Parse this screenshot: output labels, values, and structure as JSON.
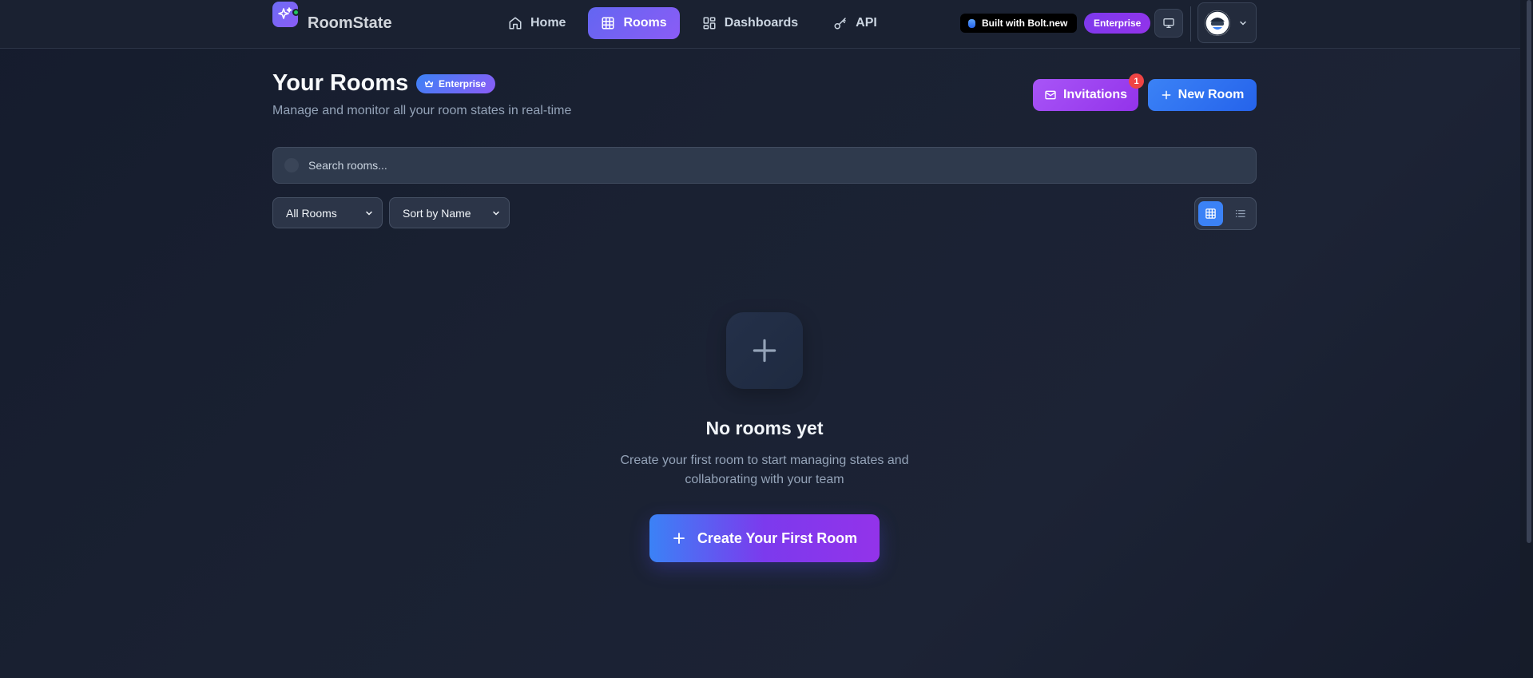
{
  "app": {
    "name": "RoomState"
  },
  "nav": {
    "items": [
      {
        "label": "Home",
        "icon": "home-icon",
        "active": false
      },
      {
        "label": "Rooms",
        "icon": "grid-icon",
        "active": true
      },
      {
        "label": "Dashboards",
        "icon": "dashboard-icon",
        "active": false
      },
      {
        "label": "API",
        "icon": "key-icon",
        "active": false
      }
    ],
    "bolt_badge": "Built with Bolt.new",
    "plan_badge": "Enterprise"
  },
  "header": {
    "title": "Your Rooms",
    "badge": "Enterprise",
    "subtitle": "Manage and monitor all your room states in real-time",
    "invitations_label": "Invitations",
    "invitations_count": "1",
    "new_room_label": "New Room"
  },
  "search": {
    "placeholder": "Search rooms..."
  },
  "filters": {
    "room_filter": "All Rooms",
    "sort": "Sort by Name"
  },
  "empty_state": {
    "title": "No rooms yet",
    "text": "Create your first room to start managing states and collaborating with your team",
    "cta_label": "Create Your First Room"
  },
  "colors": {
    "background": "#1a2132",
    "accent_purple": "#8b5cf6",
    "accent_blue": "#3b82f6",
    "badge_red": "#ef4444"
  }
}
